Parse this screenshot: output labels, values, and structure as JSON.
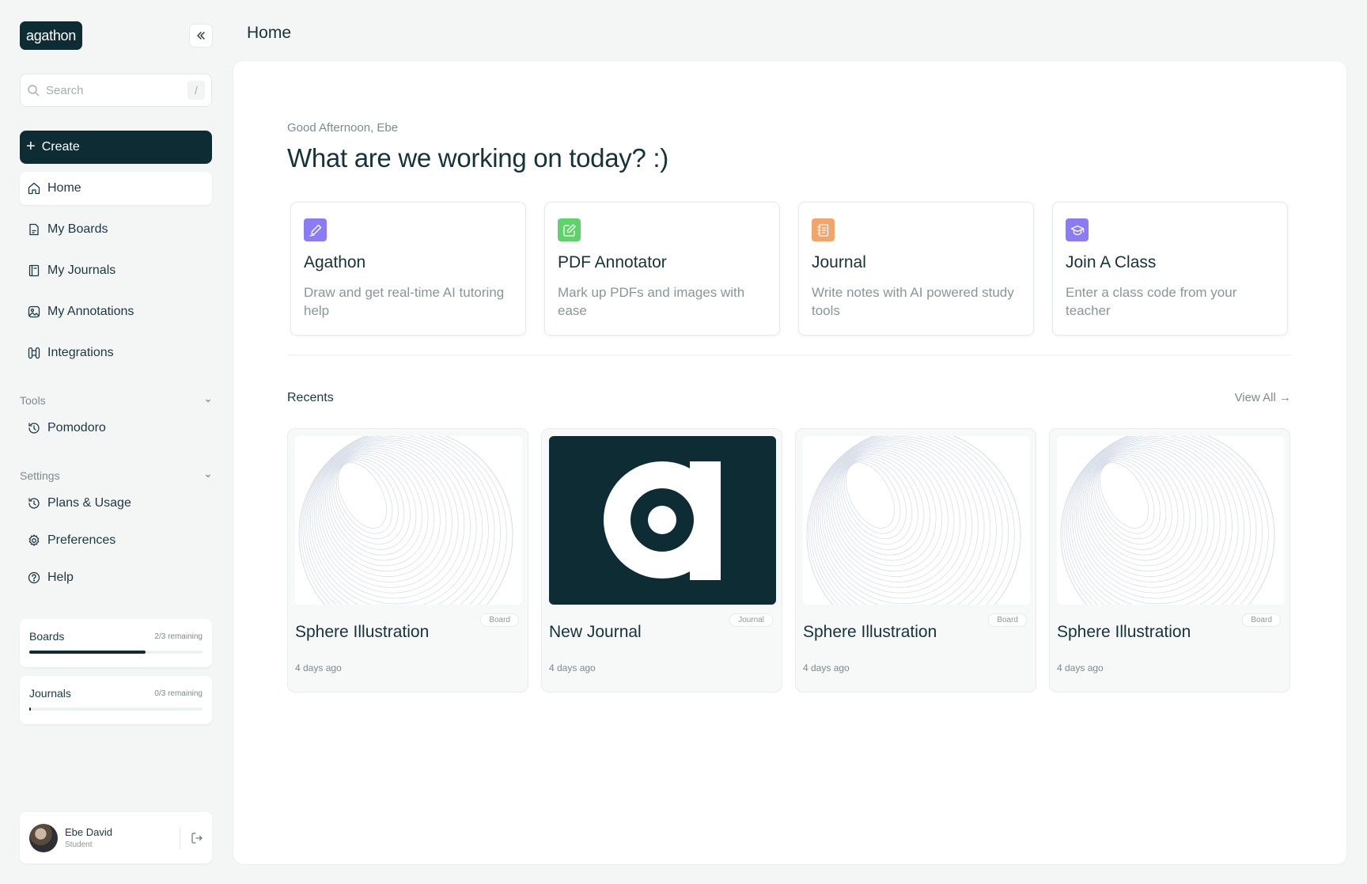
{
  "app": {
    "logo_text": "agathon"
  },
  "search": {
    "placeholder": "Search",
    "shortcut": "/"
  },
  "sidebar": {
    "create_label": "Create",
    "items": [
      {
        "label": "Home",
        "icon": "home-icon",
        "active": true
      },
      {
        "label": "My Boards",
        "icon": "boards-icon"
      },
      {
        "label": "My Journals",
        "icon": "journal-icon"
      },
      {
        "label": "My Annotations",
        "icon": "image-icon"
      },
      {
        "label": "Integrations",
        "icon": "integrations-icon"
      }
    ],
    "tools_label": "Tools",
    "tools": [
      {
        "label": "Pomodoro",
        "icon": "history-icon"
      }
    ],
    "settings_label": "Settings",
    "settings": [
      {
        "label": "Plans & Usage",
        "icon": "history-icon"
      },
      {
        "label": "Preferences",
        "icon": "gear-icon"
      },
      {
        "label": "Help",
        "icon": "help-icon"
      }
    ],
    "usage": [
      {
        "title": "Boards",
        "remaining": "2/3 remaining",
        "progress": 0.67
      },
      {
        "title": "Journals",
        "remaining": "0/3 remaining",
        "progress": 0.01
      }
    ],
    "profile": {
      "name": "Ebe David",
      "role": "Student"
    }
  },
  "header": {
    "title": "Home"
  },
  "main": {
    "greeting": "Good Afternoon, Ebe",
    "headline": "What are we working on today? :)",
    "features": [
      {
        "title": "Agathon",
        "description": "Draw and get real-time AI tutoring help",
        "icon": "pen-icon",
        "color": "#8b7cf6"
      },
      {
        "title": "PDF Annotator",
        "description": "Mark up PDFs and images with ease",
        "icon": "edit-icon",
        "color": "#5fd36a"
      },
      {
        "title": "Journal",
        "description": "Write notes with AI powered study tools",
        "icon": "notebook-icon",
        "color": "#f2a56b"
      },
      {
        "title": "Join A Class",
        "description": "Enter a class code from your teacher",
        "icon": "graduation-icon",
        "color": "#8b7cf6"
      }
    ],
    "recents_label": "Recents",
    "view_all_label": "View All →",
    "recents": [
      {
        "title": "Sphere Illustration",
        "type": "Board",
        "date": "4 days ago",
        "thumb": "sphere"
      },
      {
        "title": "New Journal",
        "type": "Journal",
        "date": "4 days ago",
        "thumb": "logo"
      },
      {
        "title": "Sphere Illustration",
        "type": "Board",
        "date": "4 days ago",
        "thumb": "sphere"
      },
      {
        "title": "Sphere Illustration",
        "type": "Board",
        "date": "4 days ago",
        "thumb": "sphere"
      }
    ]
  }
}
